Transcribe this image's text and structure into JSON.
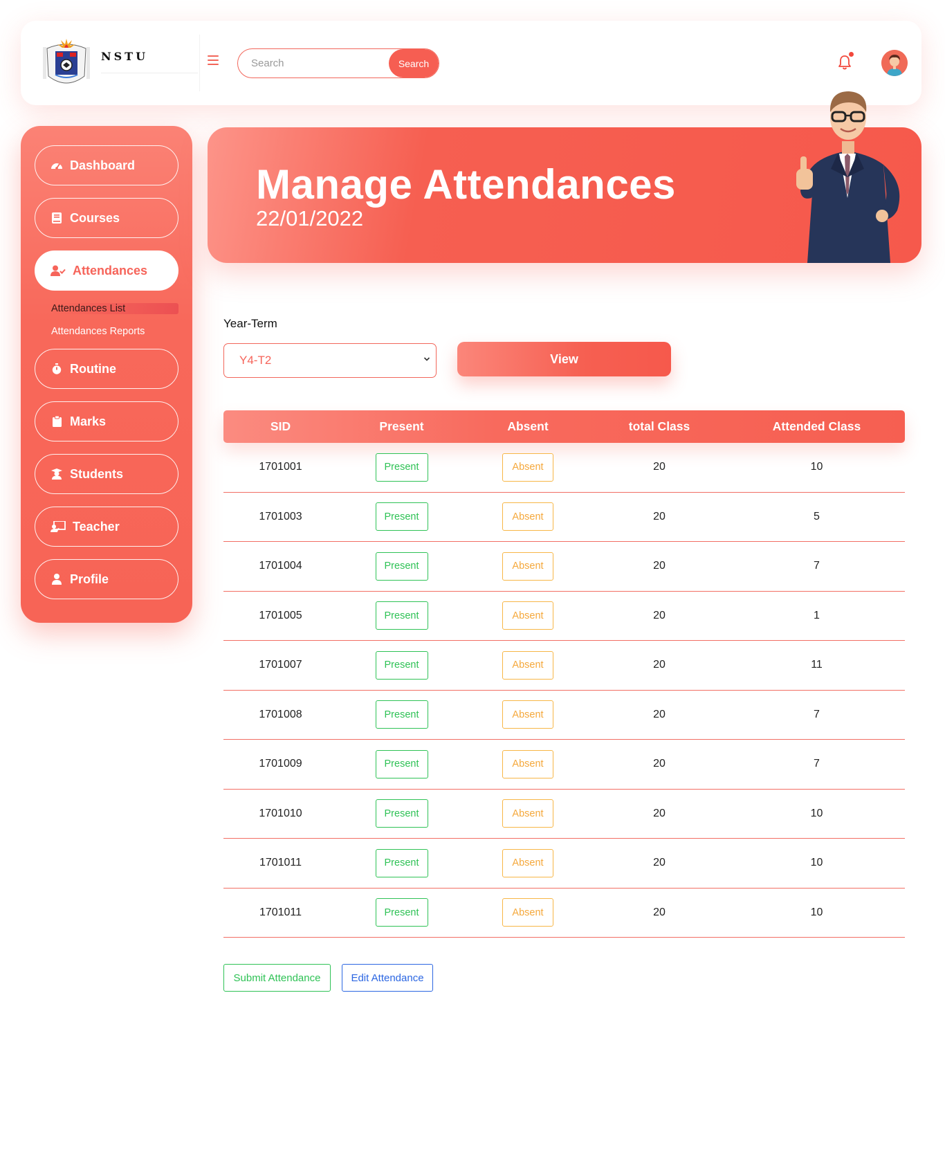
{
  "header": {
    "brand": "NSTU",
    "search_placeholder": "Search",
    "search_button": "Search"
  },
  "sidebar": {
    "items": [
      {
        "label": "Dashboard",
        "icon": "gauge-icon"
      },
      {
        "label": "Courses",
        "icon": "book-icon"
      },
      {
        "label": "Attendances",
        "icon": "user-check-icon",
        "active": true
      },
      {
        "label": "Routine",
        "icon": "stopwatch-icon"
      },
      {
        "label": "Marks",
        "icon": "clipboard-icon"
      },
      {
        "label": "Students",
        "icon": "graduate-icon"
      },
      {
        "label": "Teacher",
        "icon": "chalkboard-teacher-icon"
      },
      {
        "label": "Profile",
        "icon": "user-icon"
      }
    ],
    "subitems": [
      {
        "label": "Attendances List",
        "current": true
      },
      {
        "label": "Attendances Reports"
      }
    ]
  },
  "hero": {
    "title": "Manage Attendances",
    "date": "22/01/2022"
  },
  "filter": {
    "label": "Year-Term",
    "selected": "Y4-T2",
    "view_button": "View"
  },
  "table": {
    "headers": [
      "SID",
      "Present",
      "Absent",
      "total Class",
      "Attended Class"
    ],
    "present_label": "Present",
    "absent_label": "Absent",
    "rows": [
      {
        "sid": "1701001",
        "total": "20",
        "attended": "10"
      },
      {
        "sid": "1701003",
        "total": "20",
        "attended": "5"
      },
      {
        "sid": "1701004",
        "total": "20",
        "attended": "7"
      },
      {
        "sid": "1701005",
        "total": "20",
        "attended": "1"
      },
      {
        "sid": "1701007",
        "total": "20",
        "attended": "11"
      },
      {
        "sid": "1701008",
        "total": "20",
        "attended": "7"
      },
      {
        "sid": "1701009",
        "total": "20",
        "attended": "7"
      },
      {
        "sid": "1701010",
        "total": "20",
        "attended": "10"
      },
      {
        "sid": "1701011",
        "total": "20",
        "attended": "10"
      },
      {
        "sid": "1701011",
        "total": "20",
        "attended": "10"
      }
    ]
  },
  "actions": {
    "submit": "Submit Attendance",
    "edit": "Edit Attendance"
  },
  "colors": {
    "accent": "#f65e52",
    "present": "#2ec255",
    "absent": "#f5a83b",
    "edit": "#2b66e2"
  }
}
